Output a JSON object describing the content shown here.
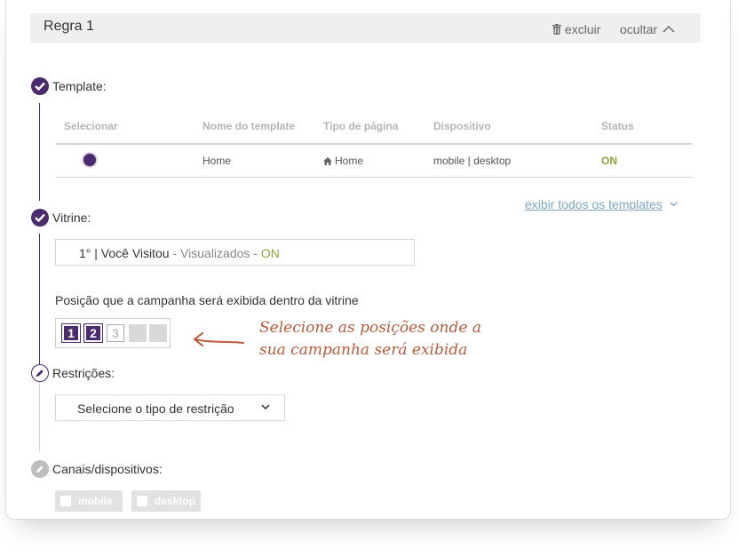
{
  "rule": {
    "title": "Regra 1",
    "delete_label": "excluir",
    "hide_label": "ocultar"
  },
  "template_section": {
    "label": "Template:",
    "columns": [
      "Selecionar",
      "Nome do template",
      "Tipo de página",
      "Dispositivo",
      "Status"
    ],
    "row": {
      "name": "Home",
      "page_type": "Home",
      "device": "mobile | desktop",
      "status": "ON"
    },
    "show_all_link": "exibir todos os templates"
  },
  "vitrine_section": {
    "label": "Vitrine:",
    "selected_prefix": "1° | Você Visitou",
    "selected_middle": " - Visualizados - ",
    "selected_status": "ON",
    "position_label": "Posição que a campanha será exibida dentro da vitrine",
    "positions": [
      "1",
      "2",
      "3",
      "",
      ""
    ],
    "annotation_line1": "Selecione as posições onde a",
    "annotation_line2": "sua campanha será exibida"
  },
  "restrictions_section": {
    "label": "Restrições:",
    "select_value": "Selecione o tipo de restrição"
  },
  "channels_section": {
    "label": "Canais/dispositivos:",
    "options": [
      "mobile",
      "desktop"
    ]
  },
  "colors": {
    "accent": "#4b2a6f",
    "status_on": "#8aa33a",
    "link": "#7fa4c7",
    "annotation": "#b85a3c"
  }
}
